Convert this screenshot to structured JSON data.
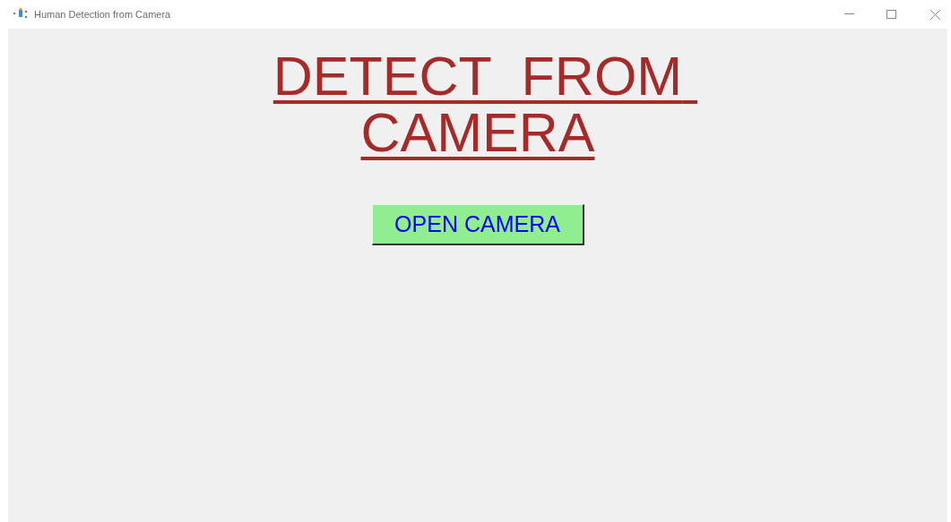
{
  "window": {
    "title": "Human Detection from Camera"
  },
  "heading": "DETECT  FROM CAMERA",
  "button": "OPEN CAMERA"
}
